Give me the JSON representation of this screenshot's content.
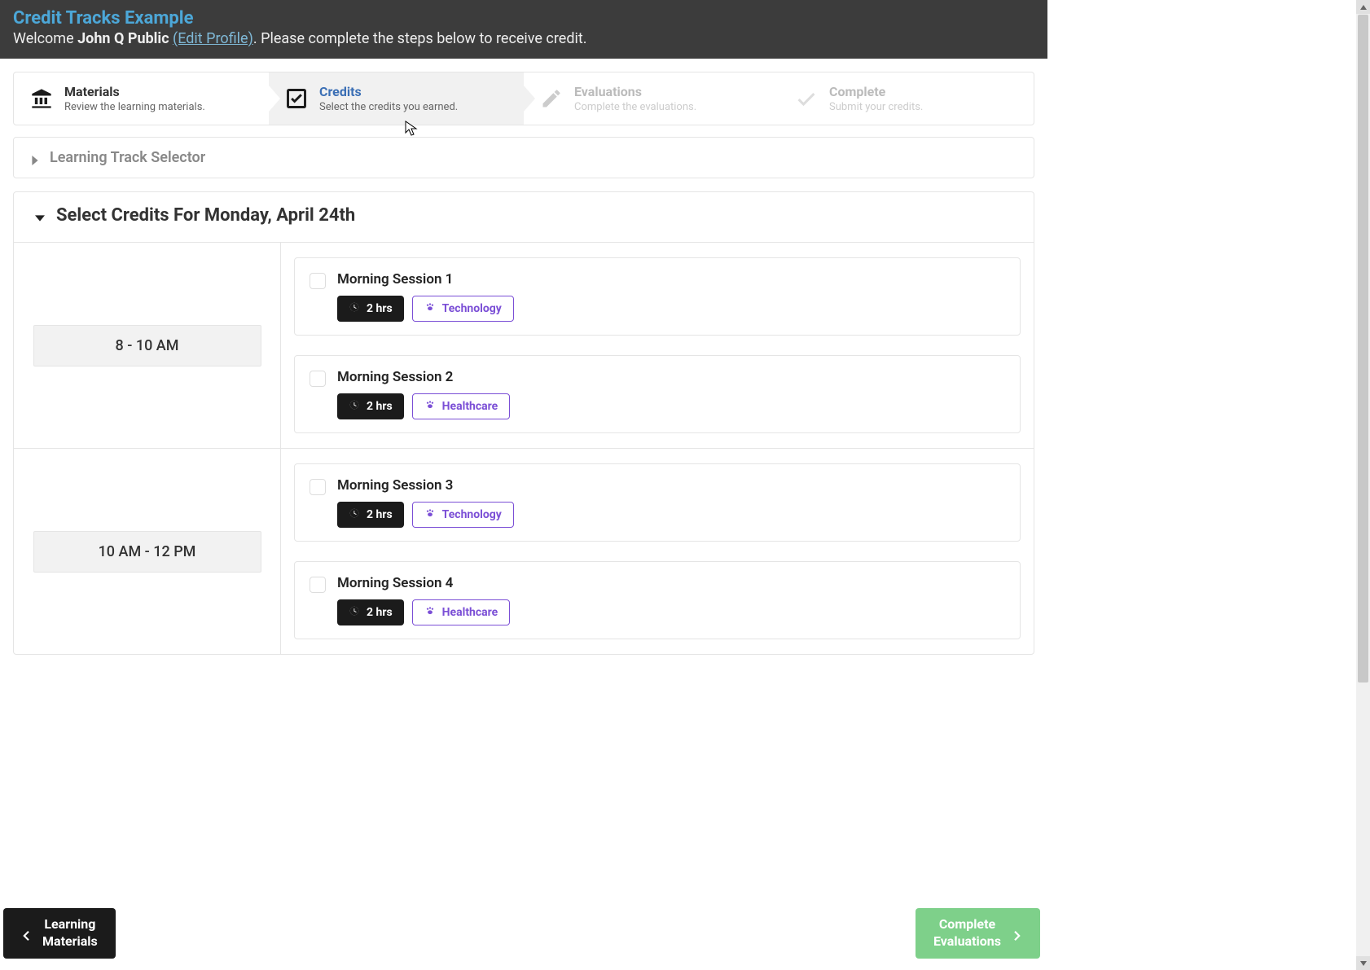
{
  "header": {
    "title": "Credit Tracks Example",
    "welcome_prefix": "Welcome ",
    "user_name": "John Q Public",
    "edit_profile": "(Edit Profile)",
    "welcome_suffix": ". Please complete the steps below to receive credit."
  },
  "steps": {
    "materials": {
      "title": "Materials",
      "desc": "Review the learning materials."
    },
    "credits": {
      "title": "Credits",
      "desc": "Select the credits you earned."
    },
    "evaluations": {
      "title": "Evaluations",
      "desc": "Complete the evaluations."
    },
    "complete": {
      "title": "Complete",
      "desc": "Submit your credits."
    }
  },
  "learning_track_selector": {
    "title": "Learning Track Selector"
  },
  "credits_panel": {
    "title": "Select Credits For Monday, April 24th",
    "time_blocks": [
      {
        "time_label": "8 - 10 AM",
        "sessions": [
          {
            "title": "Morning Session 1",
            "duration": "2 hrs",
            "category": "Technology"
          },
          {
            "title": "Morning Session 2",
            "duration": "2 hrs",
            "category": "Healthcare"
          }
        ]
      },
      {
        "time_label": "10 AM - 12 PM",
        "sessions": [
          {
            "title": "Morning Session 3",
            "duration": "2 hrs",
            "category": "Technology"
          },
          {
            "title": "Morning Session 4",
            "duration": "2 hrs",
            "category": "Healthcare"
          }
        ]
      }
    ]
  },
  "nav": {
    "prev_line1": "Learning",
    "prev_line2": "Materials",
    "next_line1": "Complete",
    "next_line2": "Evaluations"
  }
}
